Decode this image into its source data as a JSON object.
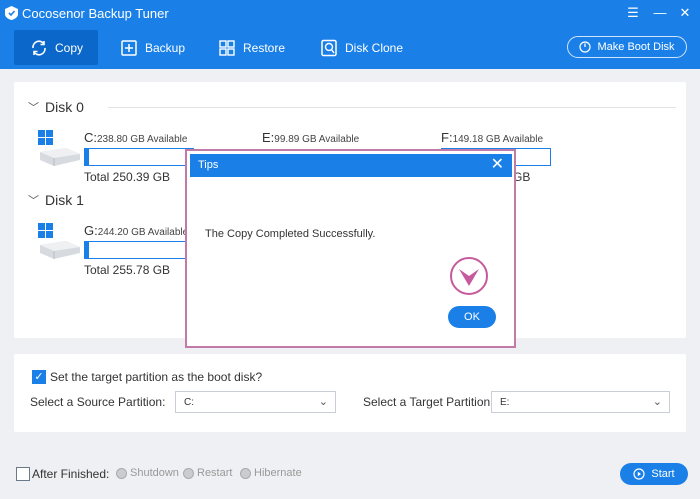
{
  "app": {
    "title": "Cocosenor Backup Tuner"
  },
  "window_controls": {
    "menu": "☰",
    "minimize": "—",
    "close": "✕"
  },
  "toolbar": {
    "items": [
      {
        "label": "Copy",
        "icon": "copy-icon",
        "active": true
      },
      {
        "label": "Backup",
        "icon": "backup-icon",
        "active": false
      },
      {
        "label": "Restore",
        "icon": "restore-icon",
        "active": false
      },
      {
        "label": "Disk Clone",
        "icon": "disk-clone-icon",
        "active": false
      }
    ],
    "make_boot_disk": "Make Boot Disk"
  },
  "disks": [
    {
      "name": "Disk 0",
      "partitions": [
        {
          "letter": "C:",
          "available": "238.80 GB Available",
          "total": "Total 250.39 GB",
          "used_fraction": 0.04
        },
        {
          "letter": "E:",
          "available": "99.89 GB Available",
          "total": "",
          "used_fraction": 0.02
        },
        {
          "letter": "F:",
          "available": "149.18 GB Available",
          "total": "GB",
          "used_fraction": 0.02
        }
      ]
    },
    {
      "name": "Disk 1",
      "partitions": [
        {
          "letter": "G:",
          "available": "244.20 GB Available",
          "total": "Total 255.78 GB",
          "used_fraction": 0.04
        }
      ]
    }
  ],
  "options": {
    "set_boot_label": "Set the target partition as the boot disk?",
    "set_boot_checked": true,
    "source_label": "Select a Source Partition:",
    "source_value": "C:",
    "target_label": "Select a Target Partition:",
    "target_value": "E:"
  },
  "after_finished": {
    "label": "After Finished:",
    "checked": false,
    "choices": [
      "Shutdown",
      "Restart",
      "Hibernate"
    ]
  },
  "start_label": "Start",
  "dialog": {
    "title": "Tips",
    "message": "The Copy Completed Successfully.",
    "ok_label": "OK"
  },
  "colors": {
    "accent": "#1a80e8",
    "accent_dark": "#0b67c9",
    "dialog_border": "#c27ba8",
    "checkmark": "#c65a9c"
  }
}
